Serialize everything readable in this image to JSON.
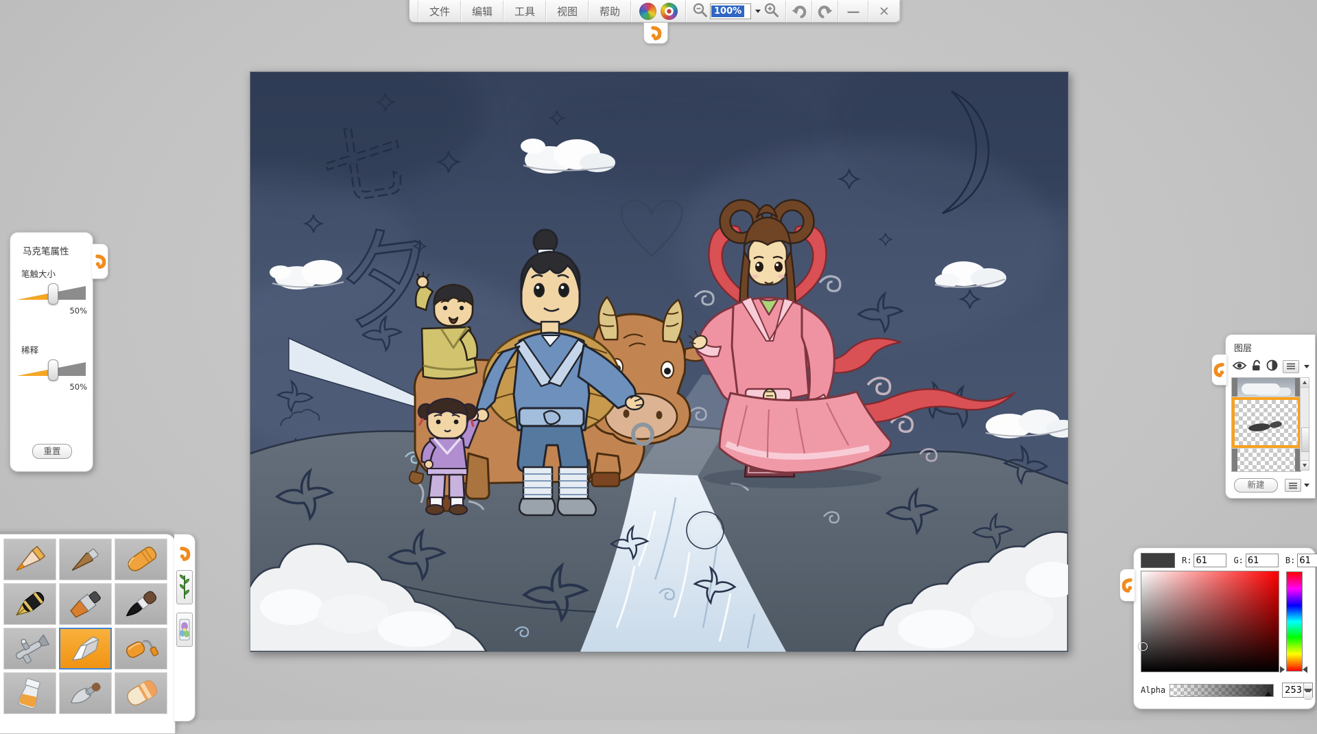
{
  "app": {
    "background_color": "#c6c6c6",
    "accent_orange": "#f1931c",
    "selection_blue": "#3f86d8"
  },
  "toolbar": {
    "menus": [
      "文件",
      "编辑",
      "工具",
      "视图",
      "帮助"
    ],
    "zoom_value": "100%",
    "minimize_glyph": "—",
    "close_glyph": "✕",
    "icons": [
      "rainbow-palette-icon",
      "rainbow-swirl-icon",
      "zoom-out-icon",
      "zoom-in-icon",
      "undo-icon",
      "redo-icon"
    ]
  },
  "marker_panel": {
    "title": "马克笔属性",
    "sliders": [
      {
        "label": "笔触大小",
        "value": "50%"
      },
      {
        "label": "稀释",
        "value": "50%"
      }
    ],
    "reset_label": "重置"
  },
  "tool_palette": {
    "tools": [
      "pencil",
      "wood-pen",
      "crayon",
      "fountain-pen",
      "flat-brush",
      "ink-brush",
      "airbrush",
      "marker",
      "paint-roller",
      "ink-bottle",
      "palette-knife",
      "eraser"
    ],
    "selected_tool": "marker",
    "side_tabs": [
      "plant-brush-tab",
      "stamp-tab"
    ]
  },
  "layers_panel": {
    "title": "图层",
    "new_button_label": "新建",
    "icons": [
      "eye",
      "unlock",
      "blend",
      "menu"
    ]
  },
  "color_picker": {
    "current_color": "#3d3d3d",
    "r_label": "R:",
    "r_value": "61",
    "g_label": "G:",
    "g_value": "61",
    "b_label": "B:",
    "b_value": "61",
    "alpha_label": "Alpha",
    "alpha_value": "253"
  },
  "canvas": {
    "scene": "Cowherd and Weaver Girl (Qixi) night illustration",
    "sketch_characters": [
      "七",
      "夕"
    ],
    "sky_color": "#45536e",
    "ground_color": "#59636f",
    "river_color": "#e3edf6",
    "figures": [
      "cowherd",
      "weaver-girl",
      "boy-on-ox",
      "little-girl",
      "ox"
    ]
  }
}
